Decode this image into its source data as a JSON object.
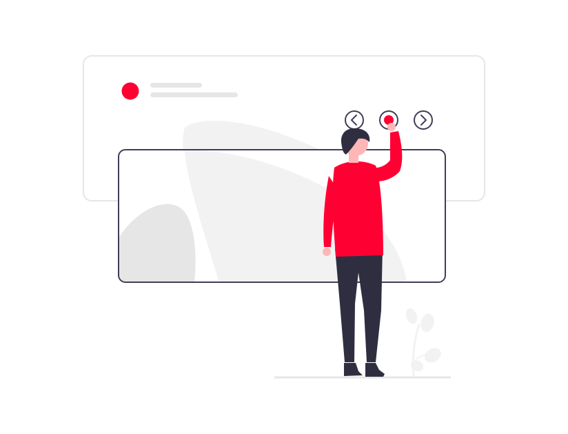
{
  "illustration": {
    "accent_color": "#ff0033",
    "outline_color": "#3f3d56",
    "card_border_color": "#e6e6e6",
    "placeholder_color": "#e6e6e6",
    "blob_color": "#f2f2f2",
    "shirt_color": "#ff0033",
    "pants_color": "#2f2e41",
    "skin_color": "#ffb6b6",
    "hair_color": "#2f2e41"
  },
  "back_card": {
    "avatar_icon": "red-dot-avatar",
    "title_placeholder": "",
    "subtitle_placeholder": ""
  },
  "carousel": {
    "prev_icon": "chevron-left-icon",
    "dot_icon": "dot-icon",
    "next_icon": "chevron-right-icon",
    "active_index": 1
  },
  "front_card": {
    "image_icon": "image-placeholder"
  }
}
